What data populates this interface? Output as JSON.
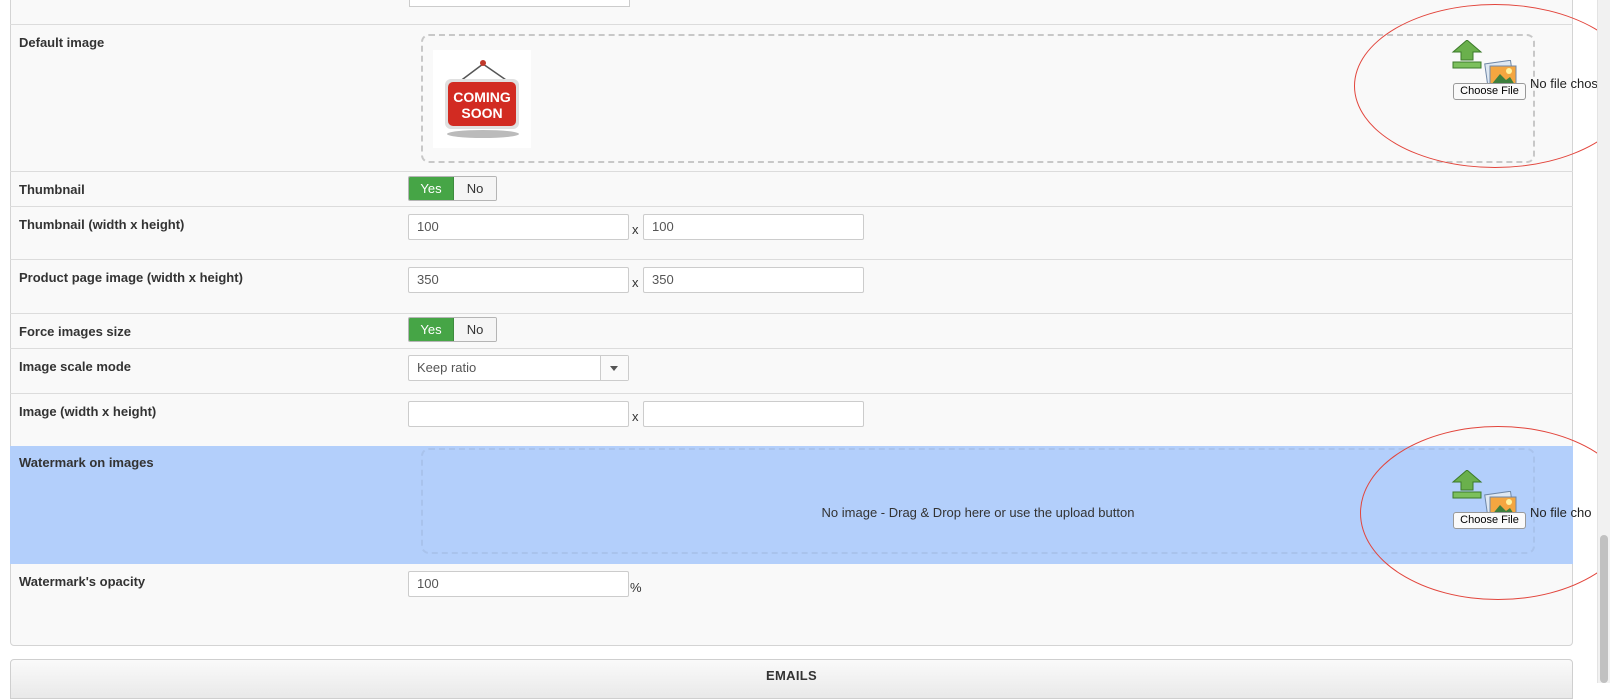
{
  "default_image": {
    "label": "Default image",
    "sign_line1": "COMING",
    "sign_line2": "SOON",
    "choose_file_label": "Choose File",
    "no_file_text": "No file chos"
  },
  "thumbnail": {
    "label": "Thumbnail",
    "yes": "Yes",
    "no": "No",
    "selected": "Yes"
  },
  "thumbnail_size": {
    "label": "Thumbnail (width x height)",
    "width": "100",
    "height": "100",
    "separator": "x"
  },
  "product_page_size": {
    "label": "Product page image (width x height)",
    "width": "350",
    "height": "350",
    "separator": "x"
  },
  "force_size": {
    "label": "Force images size",
    "yes": "Yes",
    "no": "No",
    "selected": "Yes"
  },
  "scale_mode": {
    "label": "Image scale mode",
    "value": "Keep ratio"
  },
  "image_size": {
    "label": "Image (width x height)",
    "width": "",
    "height": "",
    "separator": "x"
  },
  "watermark": {
    "label": "Watermark on images",
    "empty_text": "No image - Drag & Drop here or use the upload button",
    "choose_file_label": "Choose File",
    "no_file_text": "No file cho"
  },
  "watermark_opacity": {
    "label": "Watermark's opacity",
    "value": "100",
    "unit": "%"
  },
  "emails_section": {
    "title": "EMAILS"
  },
  "colors": {
    "toggle_active": "#46a546",
    "highlight_row": "#b3cffb",
    "annotation": "#e2453c"
  }
}
